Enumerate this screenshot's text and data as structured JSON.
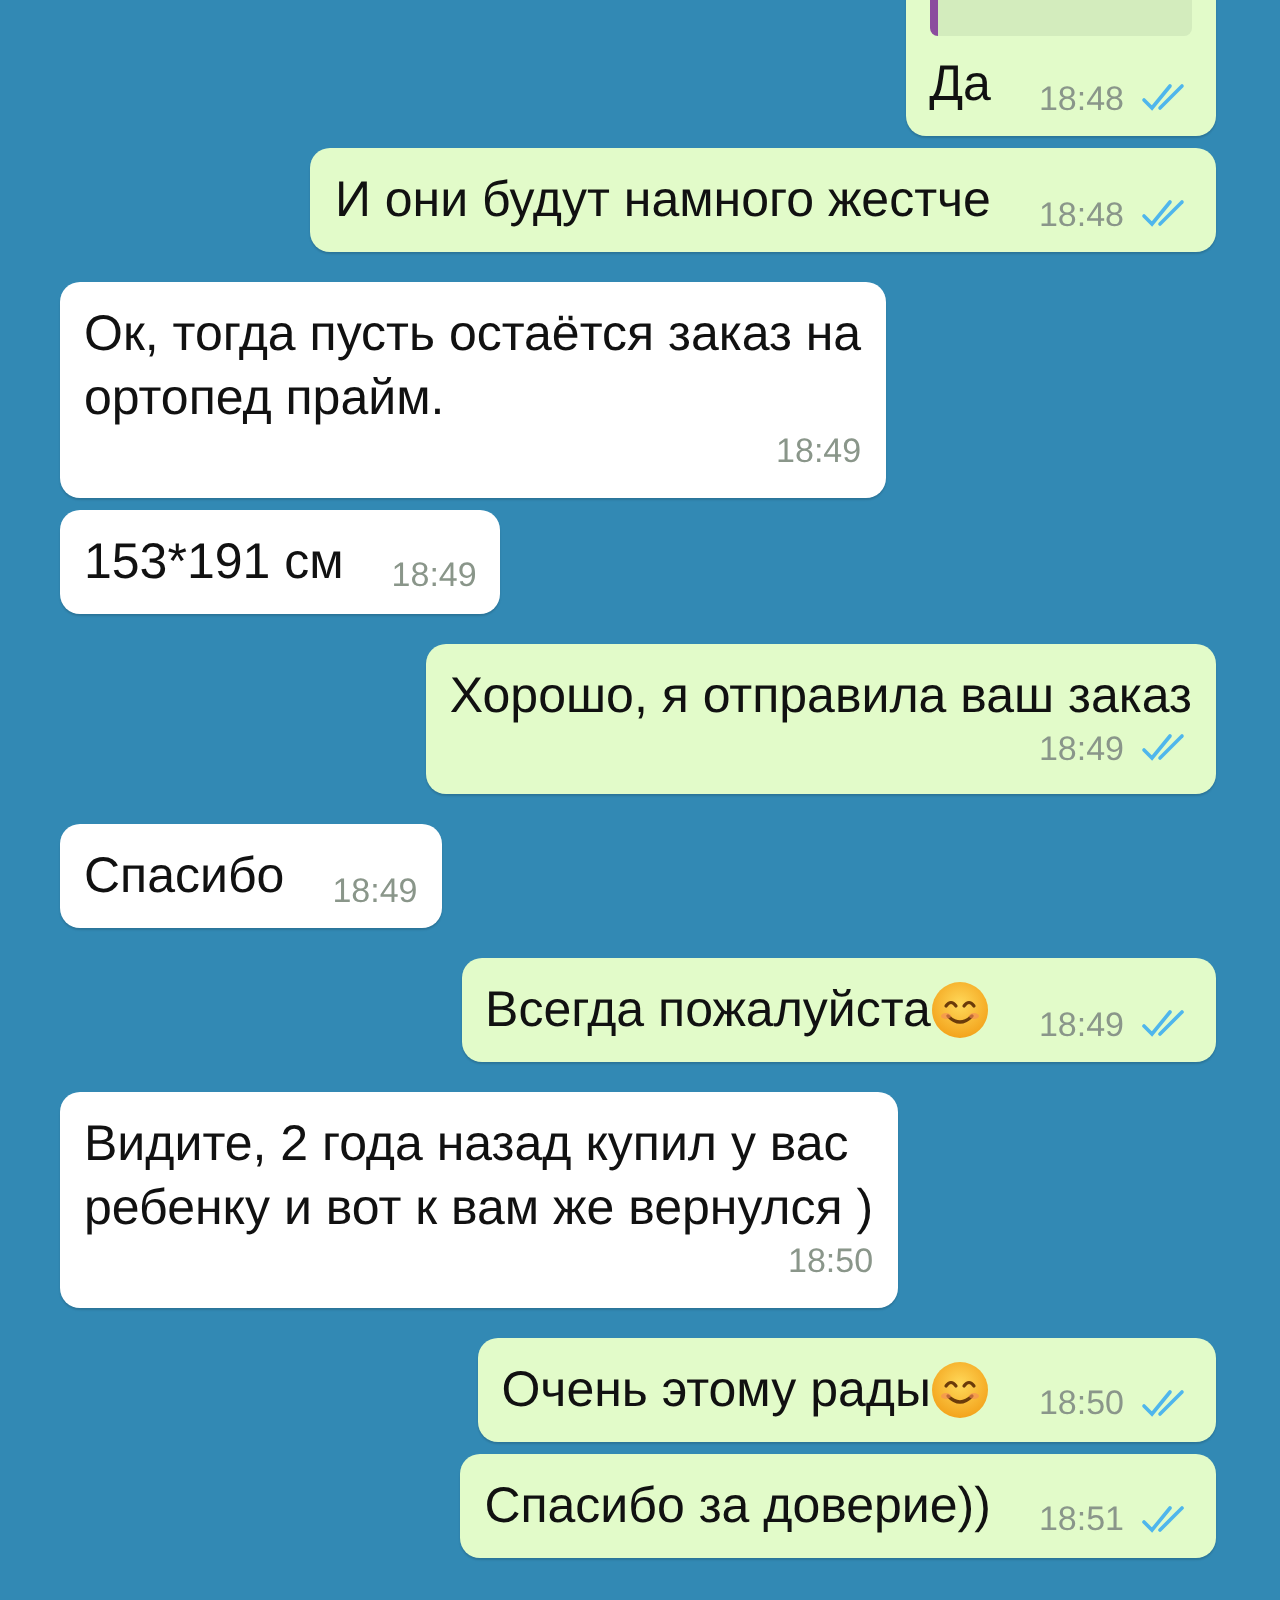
{
  "messages": [
    {
      "kind": "sent",
      "time_below": false,
      "quote": true,
      "lines": [
        "Да"
      ],
      "time": "18:48",
      "read": true,
      "smiley": false
    },
    {
      "kind": "sent",
      "time_below": false,
      "quote": false,
      "lines": [
        "И они будут намного жестче"
      ],
      "time": "18:48",
      "read": true,
      "smiley": false
    },
    {
      "kind": "received",
      "time_below": true,
      "quote": false,
      "lines": [
        "Ок, тогда пусть остаётся заказ на",
        "ортопед прайм."
      ],
      "time": "18:49",
      "smiley": false
    },
    {
      "kind": "received",
      "time_below": false,
      "quote": false,
      "lines": [
        "153*191 см"
      ],
      "time": "18:49",
      "smiley": false
    },
    {
      "kind": "sent",
      "time_below": true,
      "quote": false,
      "lines": [
        "Хорошо, я отправила ваш заказ"
      ],
      "time": "18:49",
      "read": true,
      "smiley": false
    },
    {
      "kind": "received",
      "time_below": false,
      "quote": false,
      "lines": [
        "Спасибо"
      ],
      "time": "18:49",
      "smiley": false
    },
    {
      "kind": "sent",
      "time_below": false,
      "quote": false,
      "lines": [
        "Всегда пожалуйста"
      ],
      "time": "18:49",
      "read": true,
      "smiley": true
    },
    {
      "kind": "received",
      "time_below": true,
      "quote": false,
      "lines": [
        "Видите, 2 года назад купил у вас",
        "ребенку и вот к вам же вернулся )"
      ],
      "time": "18:50",
      "smiley": false
    },
    {
      "kind": "sent",
      "time_below": false,
      "quote": false,
      "lines": [
        "Очень этому рады"
      ],
      "time": "18:50",
      "read": true,
      "smiley": true
    },
    {
      "kind": "sent",
      "time_below": false,
      "quote": false,
      "lines": [
        "Спасибо за доверие))"
      ],
      "time": "18:51",
      "read": true,
      "smiley": false
    }
  ]
}
